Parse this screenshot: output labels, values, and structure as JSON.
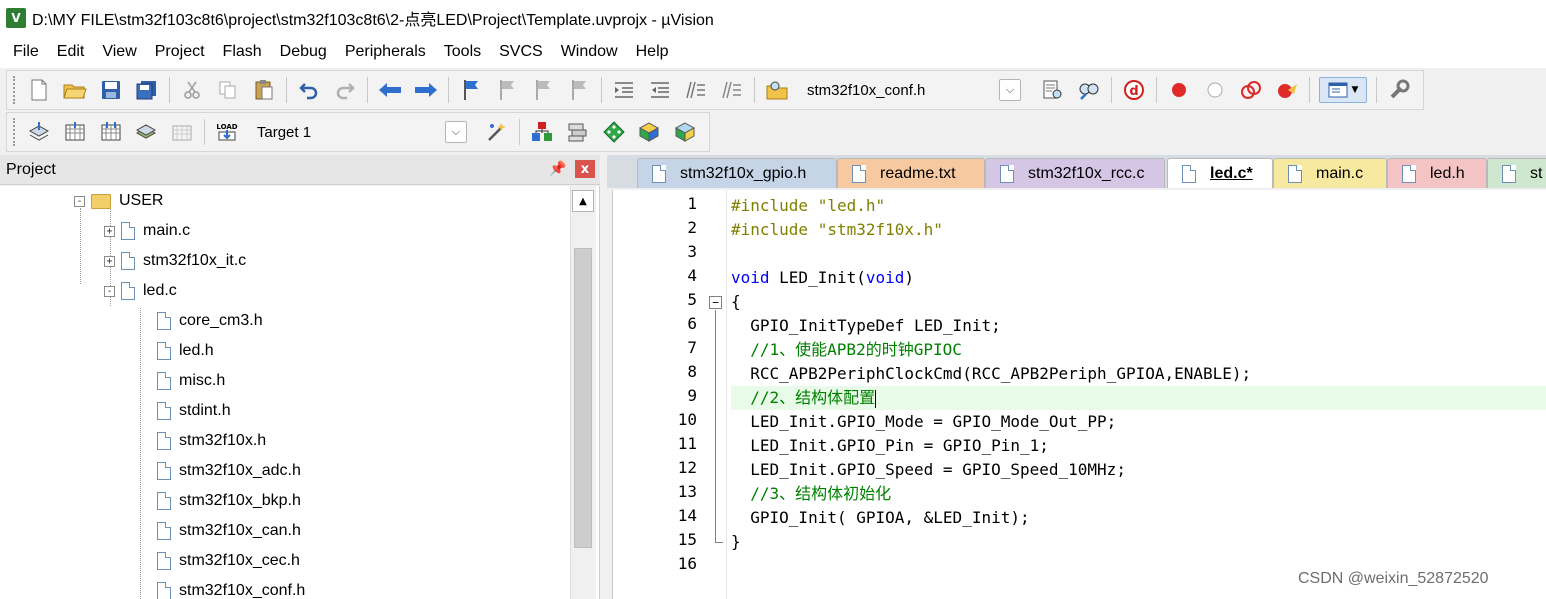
{
  "window": {
    "title": "D:\\MY FILE\\stm32f103c8t6\\project\\stm32f103c8t6\\2-点亮LED\\Project\\Template.uvprojx - µVision",
    "icon_label": "V"
  },
  "menu": [
    "File",
    "Edit",
    "View",
    "Project",
    "Flash",
    "Debug",
    "Peripherals",
    "Tools",
    "SVCS",
    "Window",
    "Help"
  ],
  "toolbar1": {
    "find_combo_value": "stm32f10x_conf.h",
    "icons": [
      "new-file-icon",
      "open-folder-icon",
      "save-icon",
      "save-all-icon",
      "cut-icon",
      "copy-icon",
      "paste-icon",
      "undo-icon",
      "redo-icon",
      "navigate-back-icon",
      "navigate-forward-icon",
      "bookmark-icon",
      "prev-bookmark-icon",
      "next-bookmark-icon",
      "clear-bookmarks-icon",
      "indent-icon",
      "unindent-icon",
      "comment-icon",
      "uncomment-icon",
      "find-in-files-icon",
      "find-icon",
      "incremental-find-icon",
      "debug-session-icon",
      "breakpoint-icon",
      "disable-breakpoint-icon",
      "disable-all-breakpoints-icon",
      "kill-breakpoints-icon",
      "window-layout-icon",
      "configure-icon"
    ]
  },
  "toolbar2": {
    "target_combo_value": "Target 1",
    "icons": [
      "translate-icon",
      "build-icon",
      "rebuild-icon",
      "batch-build-icon",
      "stop-build-icon",
      "download-icon",
      "target-options-icon",
      "file-extensions-icon",
      "manage-components-icon",
      "select-packs-icon",
      "pack-installer-icon"
    ]
  },
  "project_panel": {
    "title": "Project",
    "pin_label": "ᵖ",
    "close_label": "x",
    "tree": [
      {
        "label": "USER",
        "type": "folder",
        "expander": "-",
        "level": 0
      },
      {
        "label": "main.c",
        "type": "file",
        "expander": "+",
        "level": 1
      },
      {
        "label": "stm32f10x_it.c",
        "type": "file",
        "expander": "+",
        "level": 1
      },
      {
        "label": "led.c",
        "type": "file",
        "expander": "-",
        "level": 1
      },
      {
        "label": "core_cm3.h",
        "type": "file",
        "expander": "",
        "level": 2
      },
      {
        "label": "led.h",
        "type": "file",
        "expander": "",
        "level": 2
      },
      {
        "label": "misc.h",
        "type": "file",
        "expander": "",
        "level": 2
      },
      {
        "label": "stdint.h",
        "type": "file",
        "expander": "",
        "level": 2
      },
      {
        "label": "stm32f10x.h",
        "type": "file",
        "expander": "",
        "level": 2
      },
      {
        "label": "stm32f10x_adc.h",
        "type": "file",
        "expander": "",
        "level": 2
      },
      {
        "label": "stm32f10x_bkp.h",
        "type": "file",
        "expander": "",
        "level": 2
      },
      {
        "label": "stm32f10x_can.h",
        "type": "file",
        "expander": "",
        "level": 2
      },
      {
        "label": "stm32f10x_cec.h",
        "type": "file",
        "expander": "",
        "level": 2
      },
      {
        "label": "stm32f10x_conf.h",
        "type": "file",
        "expander": "",
        "level": 2
      }
    ]
  },
  "editor": {
    "tabs": [
      {
        "label": "stm32f10x_gpio.h",
        "color": "#c5d4e6",
        "active": false
      },
      {
        "label": "readme.txt",
        "color": "#f6c9a0",
        "active": false
      },
      {
        "label": "stm32f10x_rcc.c",
        "color": "#d5c6e6",
        "active": false
      },
      {
        "label": "led.c*",
        "color": "#ffffff",
        "active": true
      },
      {
        "label": "main.c",
        "color": "#f7eaa0",
        "active": false
      },
      {
        "label": "led.h",
        "color": "#f4c3c3",
        "active": false
      },
      {
        "label": "st",
        "color": "#cfe6cf",
        "active": false
      }
    ],
    "lines": [
      {
        "num": "1",
        "text": "#include \"led.h\""
      },
      {
        "num": "2",
        "text": "#include \"stm32f10x.h\""
      },
      {
        "num": "3",
        "text": ""
      },
      {
        "num": "4",
        "text": "void LED_Init(void)"
      },
      {
        "num": "5",
        "text": "{"
      },
      {
        "num": "6",
        "text": "  GPIO_InitTypeDef LED_Init;"
      },
      {
        "num": "7",
        "text": "  //1、使能APB2的时钟GPIOC"
      },
      {
        "num": "8",
        "text": "  RCC_APB2PeriphClockCmd(RCC_APB2Periph_GPIOA,ENABLE);"
      },
      {
        "num": "9",
        "text": "  //2、结构体配置"
      },
      {
        "num": "10",
        "text": "  LED_Init.GPIO_Mode = GPIO_Mode_Out_PP;"
      },
      {
        "num": "11",
        "text": "  LED_Init.GPIO_Pin = GPIO_Pin_1;"
      },
      {
        "num": "12",
        "text": "  LED_Init.GPIO_Speed = GPIO_Speed_10MHz;"
      },
      {
        "num": "13",
        "text": "  //3、结构体初始化"
      },
      {
        "num": "14",
        "text": "  GPIO_Init( GPIOA, &LED_Init);"
      },
      {
        "num": "15",
        "text": "}"
      },
      {
        "num": "16",
        "text": ""
      }
    ]
  },
  "watermark": "CSDN @weixin_52872520",
  "colors": {
    "preprocessor": "#808000",
    "keyword": "#0000ff",
    "comment": "#008000",
    "current_line": "#e8fbe8"
  }
}
